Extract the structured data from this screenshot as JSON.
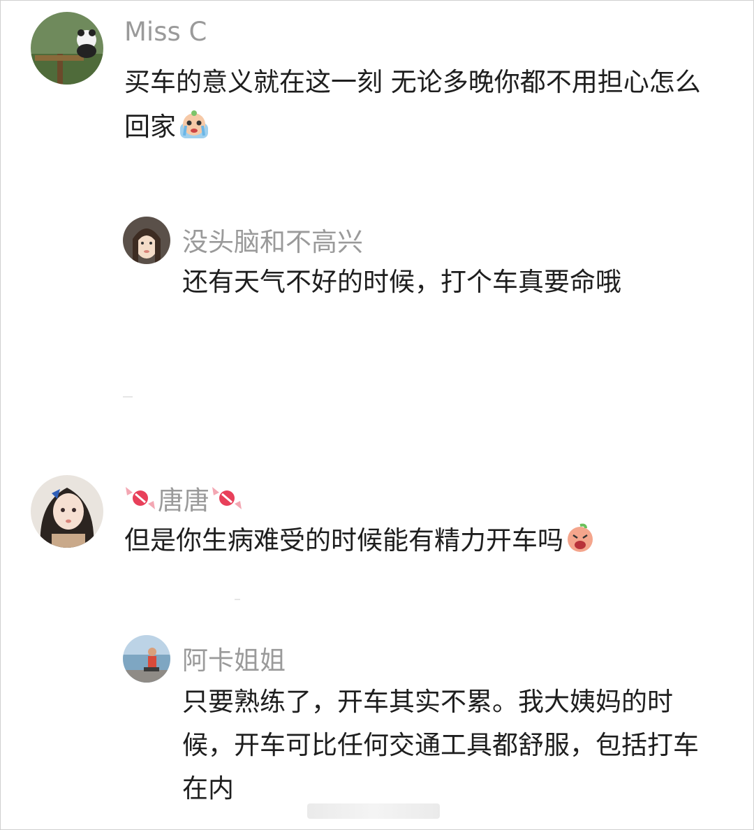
{
  "comments": [
    {
      "username": "Miss C",
      "text": "买车的意义就在这一刻 无论多晚你都不用担心怎么回家",
      "emoji": "crying-face-emoji"
    },
    {
      "username": "没头脑和不高兴",
      "text": "还有天气不好的时候，打个车真要命哦"
    },
    {
      "username": "唐唐",
      "text": "但是你生病难受的时候能有精力开车吗",
      "emoji": "exhausted-face-emoji",
      "name_decor": "candy-icon"
    },
    {
      "username": "阿卡姐姐",
      "text": "只要熟练了，开车其实不累。我大姨妈的时候，开车可比任何交通工具都舒服，包括打车在内"
    }
  ],
  "colors": {
    "username": "#9a9a9a",
    "text": "#1e1e1e"
  }
}
